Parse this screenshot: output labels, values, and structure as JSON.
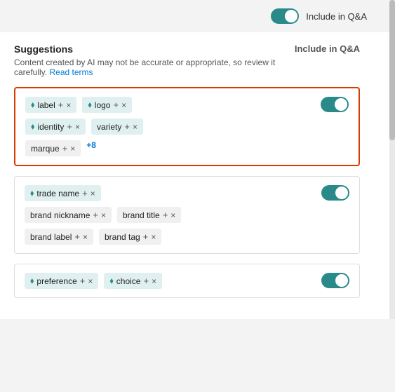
{
  "topbar": {
    "toggle_label": "Include in Q&A"
  },
  "suggestions": {
    "title": "Suggestions",
    "description": "Content created by AI may not be accurate or appropriate, so review it carefully.",
    "read_terms": "Read terms",
    "column_header": "Include in Q&A"
  },
  "cards": [
    {
      "id": "card1",
      "highlighted": true,
      "toggle_on": true,
      "rows": [
        [
          {
            "text": "label",
            "ai": false,
            "plus": true,
            "x": true
          },
          {
            "text": "logo",
            "ai": true,
            "plus": true,
            "x": true
          }
        ],
        [
          {
            "text": "identity",
            "ai": true,
            "plus": true,
            "x": true
          },
          {
            "text": "variety",
            "ai": false,
            "plus": true,
            "x": true
          }
        ],
        [
          {
            "text": "marque",
            "ai": false,
            "plus": true,
            "x": true
          },
          {
            "text": "+8",
            "badge": true
          }
        ]
      ]
    },
    {
      "id": "card2",
      "highlighted": false,
      "toggle_on": true,
      "rows": [
        [
          {
            "text": "trade name",
            "ai": true,
            "plus": true,
            "x": true
          }
        ],
        [
          {
            "text": "brand nickname",
            "ai": false,
            "plus": true,
            "x": true
          },
          {
            "text": "brand title",
            "ai": false,
            "plus": true,
            "x": true
          }
        ],
        [
          {
            "text": "brand label",
            "ai": false,
            "plus": true,
            "x": true
          },
          {
            "text": "brand tag",
            "ai": false,
            "plus": true,
            "x": true
          }
        ]
      ]
    },
    {
      "id": "card3",
      "highlighted": false,
      "toggle_on": true,
      "rows": [
        [
          {
            "text": "preference",
            "ai": true,
            "plus": true,
            "x": true
          },
          {
            "text": "choice",
            "ai": true,
            "plus": true,
            "x": true
          }
        ]
      ]
    }
  ]
}
